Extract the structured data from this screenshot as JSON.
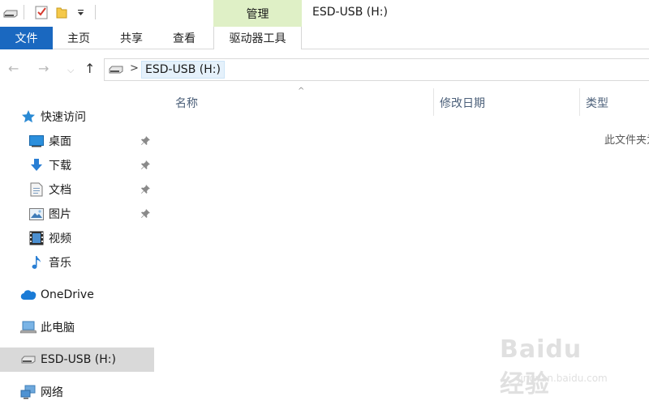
{
  "window": {
    "title": "ESD-USB (H:)"
  },
  "ribbon": {
    "context_header": "管理",
    "tabs": [
      {
        "label": "文件",
        "active": true
      },
      {
        "label": "主页"
      },
      {
        "label": "共享"
      },
      {
        "label": "查看"
      },
      {
        "label": "驱动器工具"
      }
    ]
  },
  "address": {
    "crumb": "ESD-USB (H:)"
  },
  "sidebar": {
    "quick_access": "快速访问",
    "items": [
      {
        "label": "桌面",
        "icon": "desktop-icon",
        "pinned": true
      },
      {
        "label": "下载",
        "icon": "download-icon",
        "pinned": true
      },
      {
        "label": "文档",
        "icon": "document-icon",
        "pinned": true
      },
      {
        "label": "图片",
        "icon": "picture-icon",
        "pinned": true
      },
      {
        "label": "视频",
        "icon": "video-icon"
      },
      {
        "label": "音乐",
        "icon": "music-icon"
      }
    ],
    "onedrive": "OneDrive",
    "this_pc": "此电脑",
    "usb": "ESD-USB (H:)",
    "network": "网络"
  },
  "content": {
    "columns": [
      "名称",
      "修改日期",
      "类型"
    ],
    "empty_message": "此文件夹为空。"
  },
  "watermark": {
    "big": "Baidu 经验",
    "small": "jingyan.baidu.com"
  },
  "colors": {
    "file_tab": "#1a68c0",
    "context_tab": "#dff0c6",
    "selected": "#d9d9d9",
    "accent": "#1e88e5"
  }
}
